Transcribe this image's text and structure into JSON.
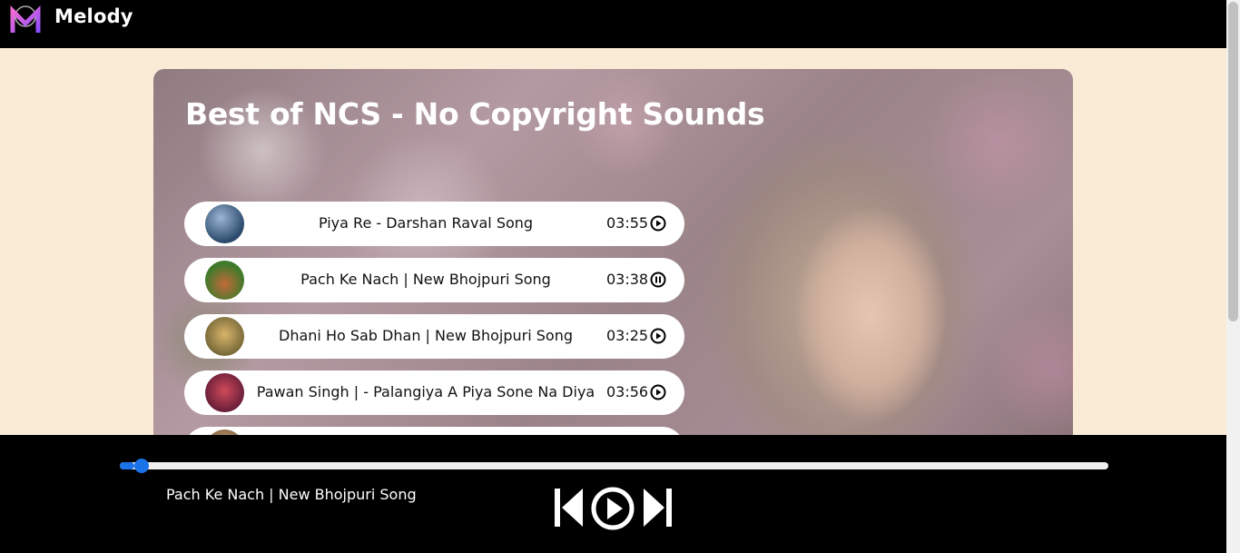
{
  "app": {
    "brand": "Melody"
  },
  "playlist": {
    "title": "Best of NCS - No Copyright Sounds",
    "songs": [
      {
        "name": "Piya Re - Darshan Raval Song",
        "duration": "03:55",
        "state_icon": "play-circle-icon",
        "cover_color": "#2b4a6b"
      },
      {
        "name": "Pach Ke Nach | New Bhojpuri Song",
        "duration": "03:38",
        "state_icon": "pause-circle-icon",
        "cover_color": "#3f7a2a"
      },
      {
        "name": "Dhani Ho Sab Dhan | New Bhojpuri Song",
        "duration": "03:25",
        "state_icon": "play-circle-icon",
        "cover_color": "#7a6a3a"
      },
      {
        "name": "Pawan Singh | - Palangiya A Piya Sone Na Diya",
        "duration": "03:56",
        "state_icon": "play-circle-icon",
        "cover_color": "#6a1f3a"
      },
      {
        "name": "",
        "duration": "",
        "state_icon": "play-circle-icon",
        "cover_color": "#8a6a4a"
      }
    ]
  },
  "player": {
    "current_song": "Pach Ke Nach | New Bhojpuri Song",
    "progress": 0.015,
    "accent_color": "#1a73e8",
    "controls": [
      "previous-icon",
      "play-icon",
      "next-icon"
    ]
  }
}
